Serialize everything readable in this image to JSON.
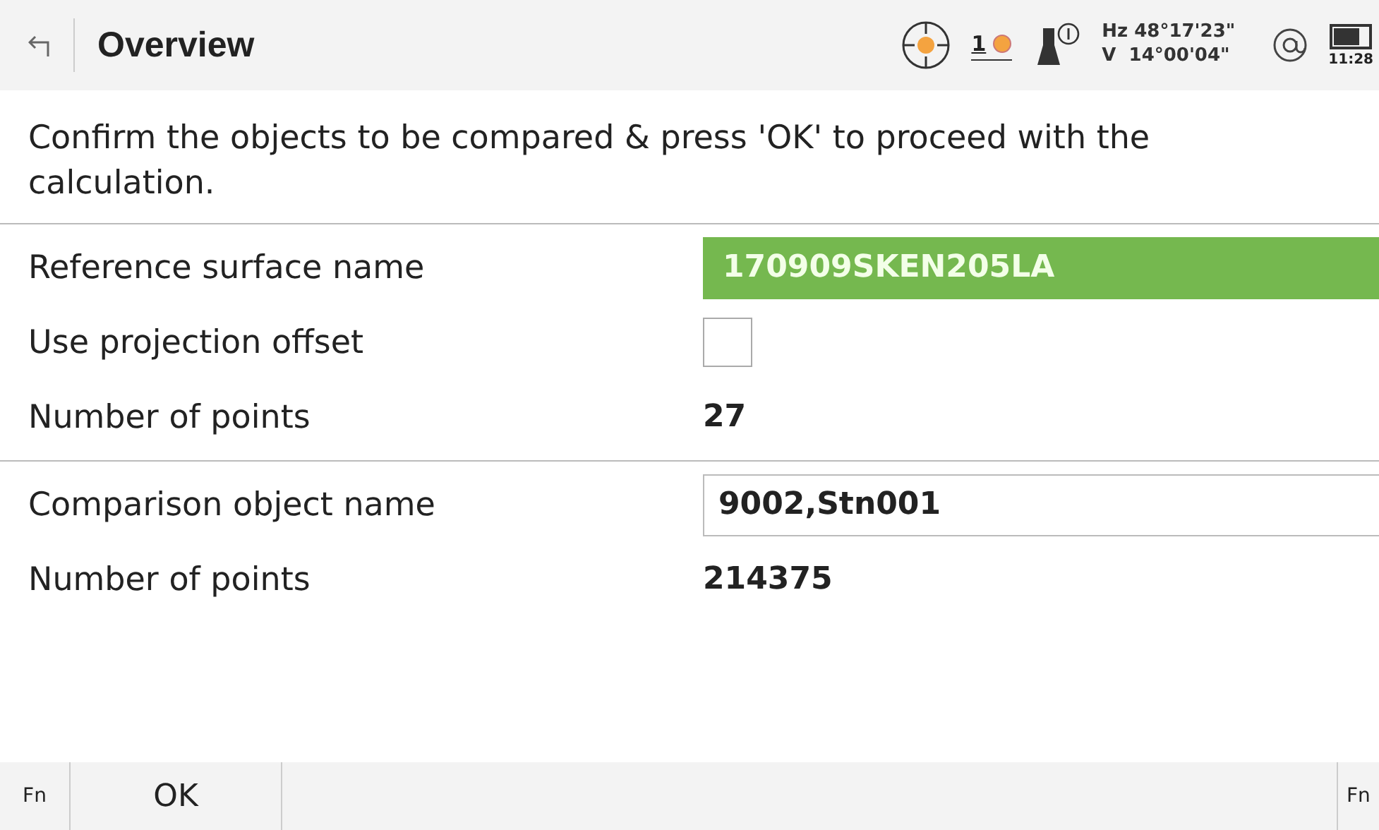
{
  "header": {
    "title": "Overview",
    "hz": "Hz 48°17'23\"",
    "v": "V  14°00'04\"",
    "prism_count": "1",
    "time": "11:28"
  },
  "instruction": "Confirm the objects to be compared & press 'OK' to proceed with the calculation.",
  "sections": [
    {
      "rows": [
        {
          "kind": "highlight",
          "label": "Reference surface name",
          "value": "170909SKEN205LA"
        },
        {
          "kind": "checkbox",
          "label": "Use projection offset",
          "checked": false
        },
        {
          "kind": "text",
          "label": "Number of points",
          "value": "27"
        }
      ]
    },
    {
      "rows": [
        {
          "kind": "field",
          "label": "Comparison object name",
          "value": "9002,Stn001"
        },
        {
          "kind": "text",
          "label": "Number of points",
          "value": "214375"
        }
      ]
    }
  ],
  "footer": {
    "left_fn": "Fn",
    "buttons": [
      "OK"
    ],
    "right_fn": "Fn"
  }
}
